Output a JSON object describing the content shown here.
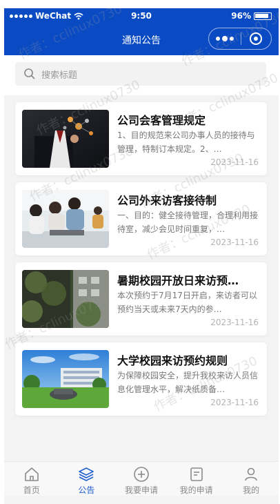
{
  "status_bar": {
    "carrier": "WeChat",
    "time": "9:50",
    "battery": "96%"
  },
  "nav": {
    "title": "通知公告"
  },
  "search": {
    "placeholder": "搜索标题"
  },
  "notices": [
    {
      "title": "公司会客管理规定",
      "summary": "1、目的规范来公司办事人员的接待与管理，特制订本规定。2、…",
      "date": "2023-11-16"
    },
    {
      "title": "公司外来访客接待制",
      "summary": "一、目的：健全接待管理，合理利用接待室，减少会见时间重复，…",
      "date": "2023-11-16"
    },
    {
      "title": "暑期校园开放日来访预…",
      "summary": "本次预约于7月17日开启，来访者可以预约当天或未来7天内的参…",
      "date": "2023-11-16"
    },
    {
      "title": "大学校园来访预约规则",
      "summary": "为保障校园安全，提升我校来访人员信息化管理水平，解决纸质备…",
      "date": "2023-11-16"
    }
  ],
  "tabs": [
    {
      "label": "首页",
      "icon": "home-icon"
    },
    {
      "label": "公告",
      "icon": "layers-icon"
    },
    {
      "label": "我要申请",
      "icon": "plus-circle-icon"
    },
    {
      "label": "我的申请",
      "icon": "document-icon"
    },
    {
      "label": "我的",
      "icon": "user-icon"
    }
  ],
  "active_tab": "公告",
  "watermark": "作者：cclinux0730",
  "colors": {
    "brand": "#0a4bc4",
    "active_tab": "#1f5fcf"
  }
}
